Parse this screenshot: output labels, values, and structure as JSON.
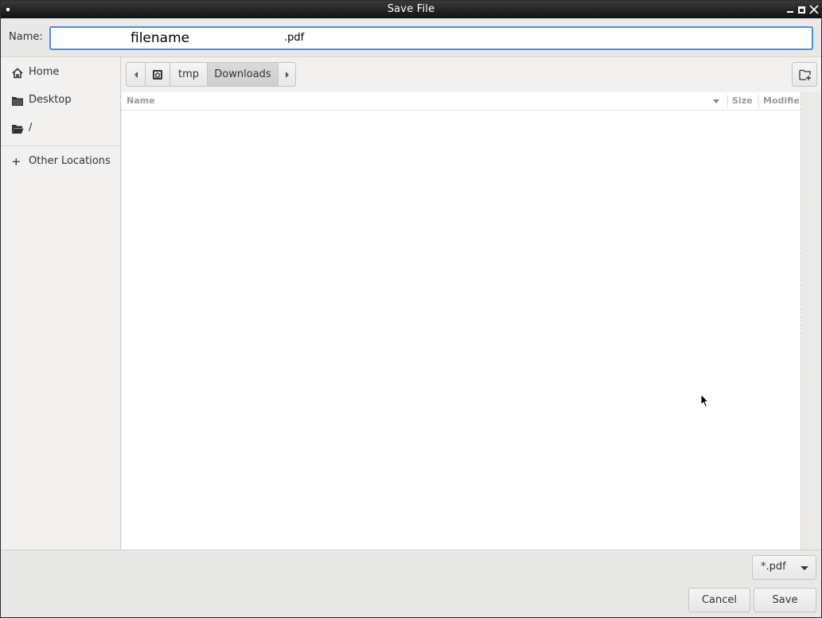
{
  "window": {
    "title": "Save File"
  },
  "name_row": {
    "label": "Name:",
    "value_name": "filename",
    "value_ext": ".pdf"
  },
  "sidebar": {
    "items": [
      {
        "label": "Home",
        "icon": "home-icon"
      },
      {
        "label": "Desktop",
        "icon": "folder-icon"
      },
      {
        "label": "/",
        "icon": "folder-open-icon"
      },
      {
        "label": "Other Locations",
        "icon": "plus-icon"
      }
    ]
  },
  "pathbar": {
    "segments": [
      "tmp",
      "Downloads"
    ],
    "active": "Downloads"
  },
  "file_list": {
    "columns": [
      "Name",
      "Size",
      "Modifie"
    ],
    "sort_column": "Name",
    "rows": []
  },
  "filter": {
    "selected": "*.pdf"
  },
  "buttons": {
    "cancel": "Cancel",
    "save": "Save"
  },
  "colors": {
    "focus_border": "#4a90d9",
    "titlebar": "#1e1e1e",
    "background": "#f2f1f0"
  }
}
